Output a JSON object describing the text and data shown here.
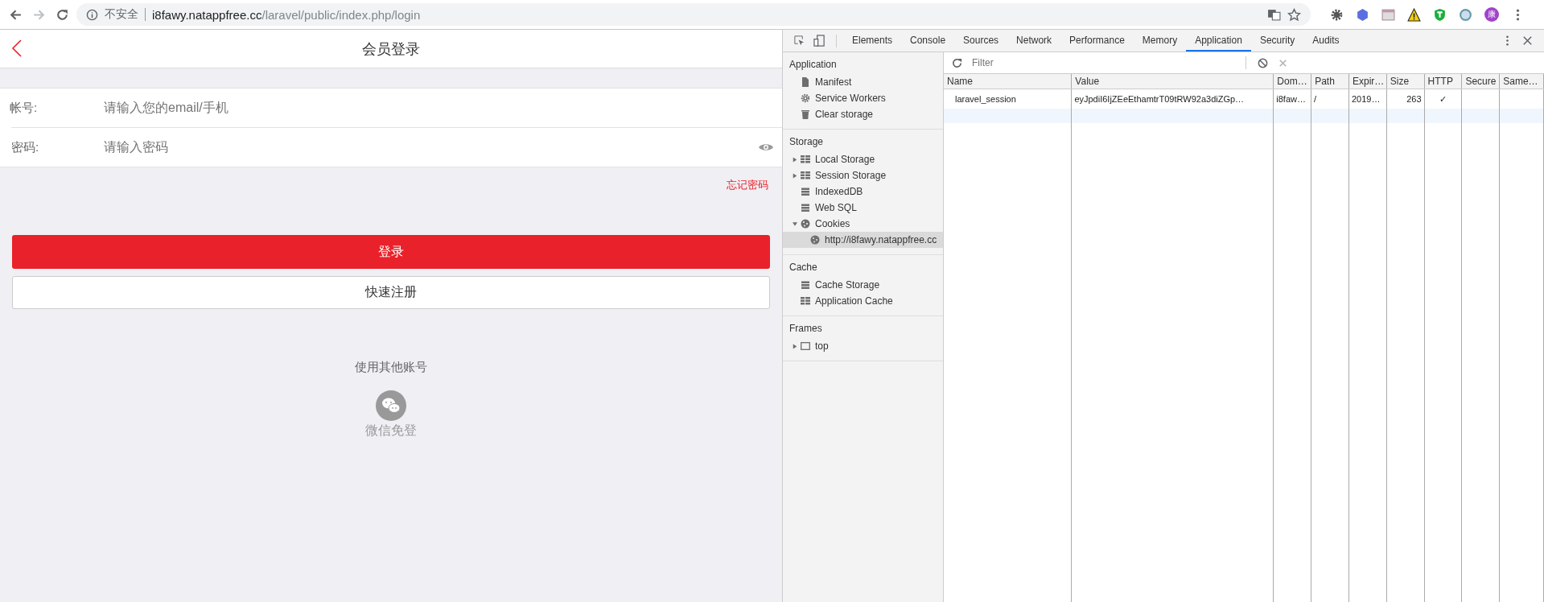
{
  "browser": {
    "security": "不安全",
    "host": "i8fawy.natappfree.cc",
    "path": "/laravel/public/index.php/login",
    "avatar": "康"
  },
  "page": {
    "title": "会员登录",
    "fields": [
      {
        "label": "帐号:",
        "placeholder": "请输入您的email/手机",
        "kind": "text"
      },
      {
        "label": "密码:",
        "placeholder": "请输入密码",
        "kind": "password"
      }
    ],
    "forgot_link": "忘记密码",
    "login_button": "登录",
    "register_button": "快速注册",
    "other_accounts": "使用其他账号",
    "wechat_label": "微信免登"
  },
  "devtools": {
    "tabs": [
      {
        "label": "Elements",
        "selected": false
      },
      {
        "label": "Console",
        "selected": false
      },
      {
        "label": "Sources",
        "selected": false
      },
      {
        "label": "Network",
        "selected": false
      },
      {
        "label": "Performance",
        "selected": false
      },
      {
        "label": "Memory",
        "selected": false
      },
      {
        "label": "Application",
        "selected": true
      },
      {
        "label": "Security",
        "selected": false
      },
      {
        "label": "Audits",
        "selected": false
      }
    ],
    "sidebar": [
      {
        "title": "Application",
        "items": [
          {
            "label": "Manifest",
            "kind": "file",
            "selected": false
          },
          {
            "label": "Service Workers",
            "kind": "gear",
            "selected": false
          },
          {
            "label": "Clear storage",
            "kind": "trash",
            "selected": false
          }
        ]
      },
      {
        "title": "Storage",
        "items": [
          {
            "label": "Local Storage",
            "kind": "grid",
            "expanded": false,
            "selected": false
          },
          {
            "label": "Session Storage",
            "kind": "grid",
            "expanded": false,
            "selected": false
          },
          {
            "label": "IndexedDB",
            "kind": "database",
            "selected": false
          },
          {
            "label": "Web SQL",
            "kind": "database",
            "selected": false
          },
          {
            "label": "Cookies",
            "kind": "cookie",
            "expanded": true,
            "selected": false,
            "children": [
              {
                "label": "http://i8fawy.natappfree.cc",
                "kind": "cookie",
                "selected": true
              }
            ]
          }
        ]
      },
      {
        "title": "Cache",
        "items": [
          {
            "label": "Cache Storage",
            "kind": "database",
            "selected": false
          },
          {
            "label": "Application Cache",
            "kind": "grid",
            "selected": false
          }
        ]
      },
      {
        "title": "Frames",
        "items": [
          {
            "label": "top",
            "kind": "frame",
            "expanded": false,
            "selected": false
          }
        ]
      }
    ],
    "filter": {
      "placeholder": "Filter"
    },
    "table": {
      "columns": [
        "Name",
        "Value",
        "Dom…",
        "Path",
        "Expir…",
        "Size",
        "HTTP",
        "Secure",
        "Same…"
      ],
      "rows": [
        [
          "laravel_session",
          "eyJpdiI6IjZEeEthamtrT09tRW92a3diZGp…",
          "i8faw…",
          "/",
          "2019…",
          "263",
          "✓",
          "",
          ""
        ]
      ]
    }
  }
}
